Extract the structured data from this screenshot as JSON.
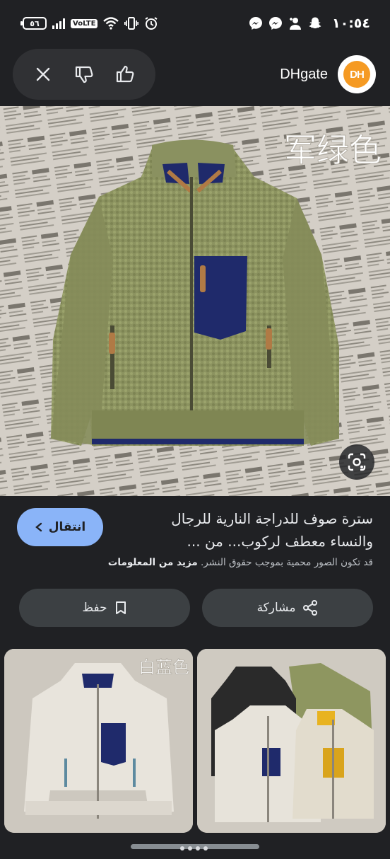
{
  "status_bar": {
    "time": "١٠:٥٤",
    "battery": "٥٦",
    "network_label": "VoLTE",
    "notification_icons": [
      "messenger-icon",
      "messenger-icon",
      "person-add-icon",
      "snapchat-icon"
    ]
  },
  "top_bar": {
    "brand_name": "DHgate",
    "brand_logo_text": "DH",
    "actions": [
      "close-icon",
      "thumbs-down-icon",
      "thumbs-up-icon"
    ]
  },
  "main_image": {
    "overlay_text": "军绿色"
  },
  "result": {
    "title_line1": "سترة صوف للدراجة النارية للرجال",
    "title_line2": "والنساء معطف لركوب... من ...",
    "visit_label": "انتقال",
    "copyright_notice": "قد تكون الصور محمية بموجب حقوق النشر.",
    "more_info_label": "مزيد من المعلومات",
    "share_label": "مشاركة",
    "save_label": "حفظ"
  },
  "related": [
    {
      "overlay_text": "白蓝色"
    },
    {
      "overlay_text": ""
    }
  ],
  "colors": {
    "background": "#202124",
    "accent_blue": "#8ab4f8",
    "button_grey": "#3c4043",
    "jacket_green": "#8e9660",
    "pocket_navy": "#1f2a6b"
  }
}
